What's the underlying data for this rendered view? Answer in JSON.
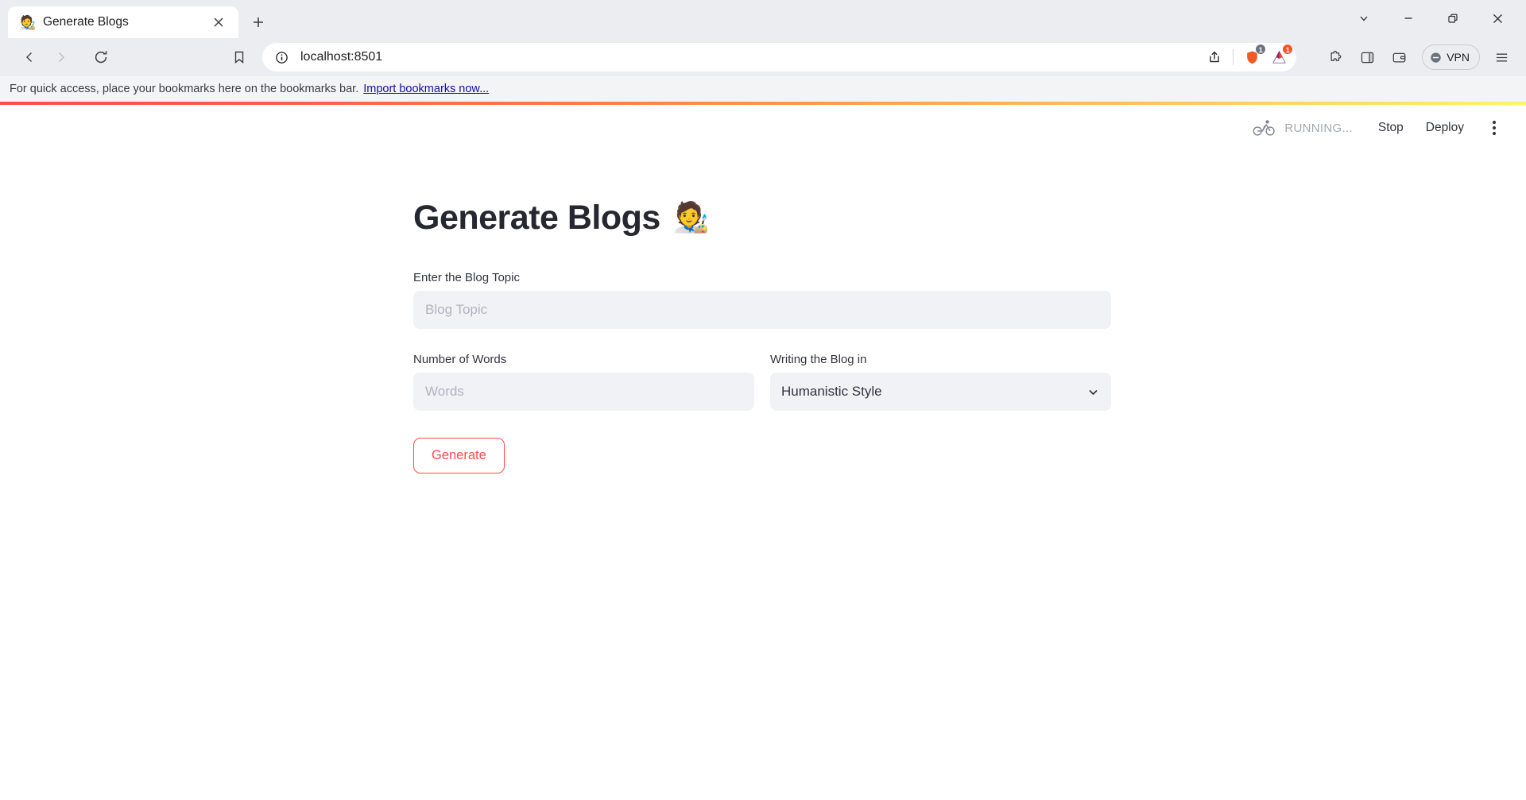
{
  "browser": {
    "tab": {
      "favicon": "artist-emoji",
      "favicon_glyph": "🧑‍🎨",
      "title": "Generate Blogs",
      "close_label": "×",
      "new_tab_label": "+"
    },
    "window_controls": {
      "tab_search": "chevron-down",
      "minimize": "minimize",
      "maximize": "maximize",
      "close": "close"
    },
    "nav": {
      "back": "back-arrow",
      "forward": "forward-arrow",
      "reload": "reload-arrow",
      "bookmark_manager": "bookmark-icon"
    },
    "omnibox": {
      "site_info_icon": "info-circle-icon",
      "url": "localhost:8501",
      "share_icon": "share-icon",
      "shields_icon": "brave-shields-lion-icon",
      "shields_badge": "1",
      "rewards_icon": "brave-rewards-bat-icon",
      "rewards_badge": "1"
    },
    "toolbar": {
      "extensions": "puzzle-icon",
      "sidebar": "sidebar-panel-icon",
      "wallet": "wallet-icon",
      "vpn_label": "VPN",
      "vpn_icon": "vpn-circle-minus-icon",
      "menu": "hamburger-menu-icon"
    },
    "bookmarks_bar": {
      "message": "For quick access, place your bookmarks here on the bookmarks bar.",
      "import_link": "Import bookmarks now..."
    }
  },
  "streamlit": {
    "loading_bar": {
      "from_color": "#ff4b4b",
      "to_color": "#fff36b"
    },
    "header": {
      "running_icon": "running-person-bicycle-icon",
      "running_text": "RUNNING...",
      "stop_label": "Stop",
      "deploy_label": "Deploy",
      "menu_icon": "kebab-menu-icon"
    },
    "app": {
      "title": "Generate Blogs",
      "title_emoji": "🧑‍🎨",
      "fields": {
        "topic": {
          "label": "Enter the Blog Topic",
          "placeholder": "Blog Topic",
          "value": ""
        },
        "words": {
          "label": "Number of Words",
          "placeholder": "Words",
          "value": ""
        },
        "style": {
          "label": "Writing the Blog in",
          "selected": "Humanistic Style",
          "chevron": "chevron-down-icon"
        }
      },
      "generate_button": {
        "label": "Generate",
        "border_color": "#ff4b4b",
        "text_color": "#ff4b4b"
      }
    }
  }
}
